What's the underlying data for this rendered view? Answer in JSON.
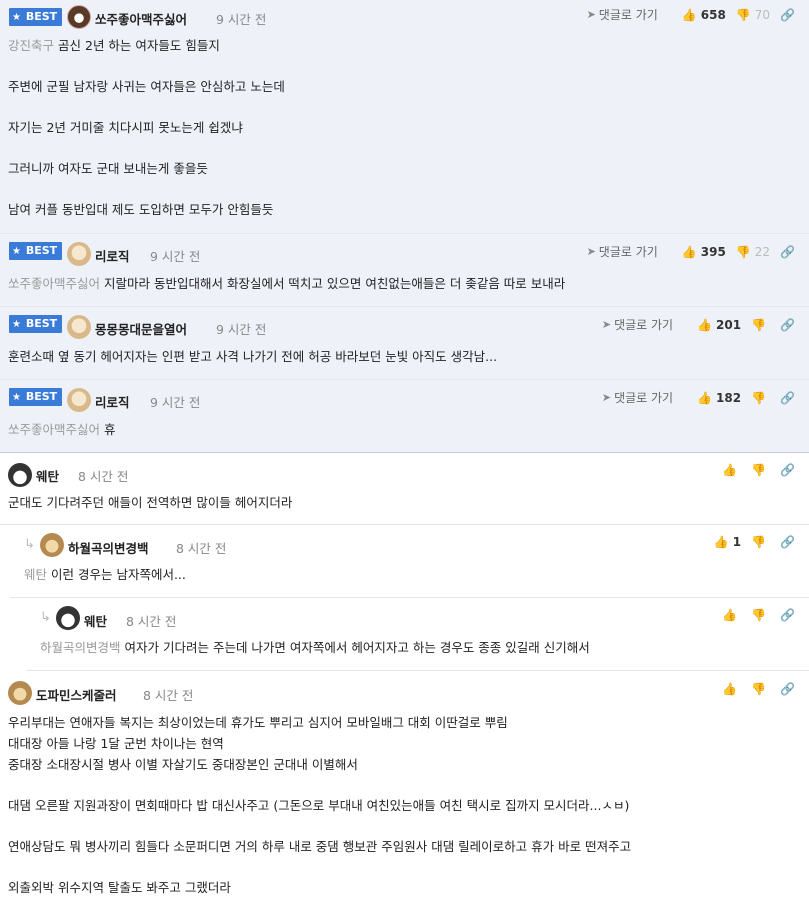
{
  "best_label": "BEST",
  "reply_label": "댓글로 가기",
  "comments": [
    {
      "nick": "쏘주좋아맥주싫어",
      "time": "9 시간 전",
      "mention": "강진축구",
      "up": "658",
      "down": "70",
      "lines": [
        "곰신 2년 하는 여자들도 힘들지",
        "주변에 군필 남자랑 사귀는 여자들은 안심하고 노는데",
        "자기는 2년 거미줄 치다시피 못노는게 쉽겠냐",
        "그러니까 여자도 군대 보내는게 좋을듯",
        "남여 커플 동반입대 제도 도입하면 모두가 안힘들듯"
      ]
    },
    {
      "nick": "리로직",
      "time": "9 시간 전",
      "mention": "쏘주좋아맥주싫어",
      "up": "395",
      "down": "22",
      "text": "지랄마라 동반입대해서 화장실에서 떡치고 있으면 여친없는애들은 더 좆같음 따로 보내라"
    },
    {
      "nick": "몽몽몽대문을열어",
      "time": "9 시간 전",
      "up": "201",
      "text": "훈련소때 옆 동기 헤어지자는 인편 받고 사격 나가기 전에 허공 바라보던 눈빛 아직도 생각남..."
    },
    {
      "nick": "리로직",
      "time": "9 시간 전",
      "mention": "쏘주좋아맥주싫어",
      "up": "182",
      "text": "휴"
    },
    {
      "nick": "웨탄",
      "time": "8 시간 전",
      "text": "군대도 기다려주던 애들이 전역하면 많이들 헤어지더라"
    },
    {
      "nick": "하월곡의변경백",
      "time": "8 시간 전",
      "mention": "웨탄",
      "up": "1",
      "text": "이런 경우는 남자쪽에서..."
    },
    {
      "nick": "웨탄",
      "time": "8 시간 전",
      "mention": "하월곡의변경백",
      "text": "여자가 기다려는 주는데 나가면 여자쪽에서 헤어지자고 하는 경우도 종종 있길래 신기해서"
    },
    {
      "nick": "도파민스케줄러",
      "time": "8 시간 전",
      "lines": [
        "우리부대는 연애자들 복지는 최상이었는데 휴가도 뿌리고 심지어 모바일배그 대회 이딴걸로 뿌림",
        "대대장 아들 나랑 1달 군번 차이나는 현역",
        "중대장 소대장시절 병사 이별 자살기도 중대장본인 군대내 이별해서",
        "대댐 오른팔 지원과장이 면회때마다 밥 대신사주고 (그돈으로 부대내 여친있는애들 여친 택시로 집까지 모시더라...ㅅㅂ)",
        "연애상담도 뭐 병사끼리 힘들다 소문퍼디면 거의 하루 내로 중댐 행보관 주임원사 대댐 릴레이로하고 휴가 바로 떤져주고",
        "외출외박 위수지역 탈출도 봐주고 그랬더라"
      ]
    }
  ],
  "icons": {
    "best_star": "star-icon",
    "reply": "send-arrow-icon",
    "up": "thumbs-up-icon",
    "down": "thumbs-down-icon",
    "link": "link-icon",
    "nested": "reply-arrow-icon"
  },
  "colors": {
    "best_badge": "#3b7bd8",
    "best_bg": "#eef2f8",
    "mention": "#999999"
  }
}
